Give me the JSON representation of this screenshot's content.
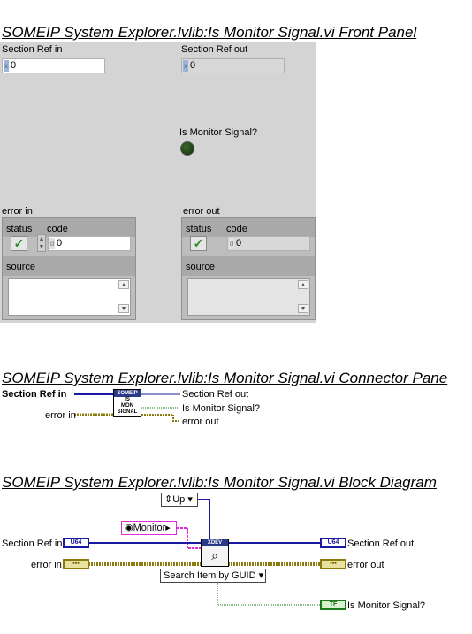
{
  "front_panel": {
    "title": "SOMEIP System Explorer.lvlib:Is Monitor Signal.vi Front Panel",
    "section_ref_in": {
      "label": "Section Ref in",
      "radix": "x",
      "value": "0"
    },
    "section_ref_out": {
      "label": "Section Ref out",
      "radix": "x",
      "value": "0"
    },
    "is_monitor_signal": {
      "label": "Is Monitor Signal?"
    },
    "error_in": {
      "label": "error in",
      "status_label": "status",
      "code_label": "code",
      "code_radix": "d",
      "code_value": "0",
      "source_label": "source",
      "check": "✓"
    },
    "error_out": {
      "label": "error out",
      "status_label": "status",
      "code_label": "code",
      "code_radix": "d",
      "code_value": "0",
      "source_label": "source",
      "check": "✓"
    }
  },
  "connector_pane": {
    "title": "SOMEIP System Explorer.lvlib:Is Monitor Signal.vi Connector Pane",
    "inputs": [
      "Section Ref in",
      "error in"
    ],
    "outputs": [
      "Section Ref out",
      "Is Monitor Signal?",
      "error out"
    ],
    "icon_header": "SOMEIP",
    "icon_lines": [
      "IS",
      "MON",
      "SIGNAL"
    ]
  },
  "block_diagram": {
    "title": "SOMEIP System Explorer.lvlib:Is Monitor Signal.vi Block Diagram",
    "direction_enum": "Up",
    "monitor_constant": "Monitor",
    "xdev_label": "XDEV",
    "search_enum": "Search Item by GUID",
    "section_ref_in": "Section Ref in",
    "error_in": "error in",
    "section_ref_out": "Section Ref out",
    "error_out": "error out",
    "is_monitor_signal": "Is Monitor Signal?",
    "u64_tag": "U64",
    "tf_tag": "TF",
    "err_tag": "▪▪▪"
  }
}
